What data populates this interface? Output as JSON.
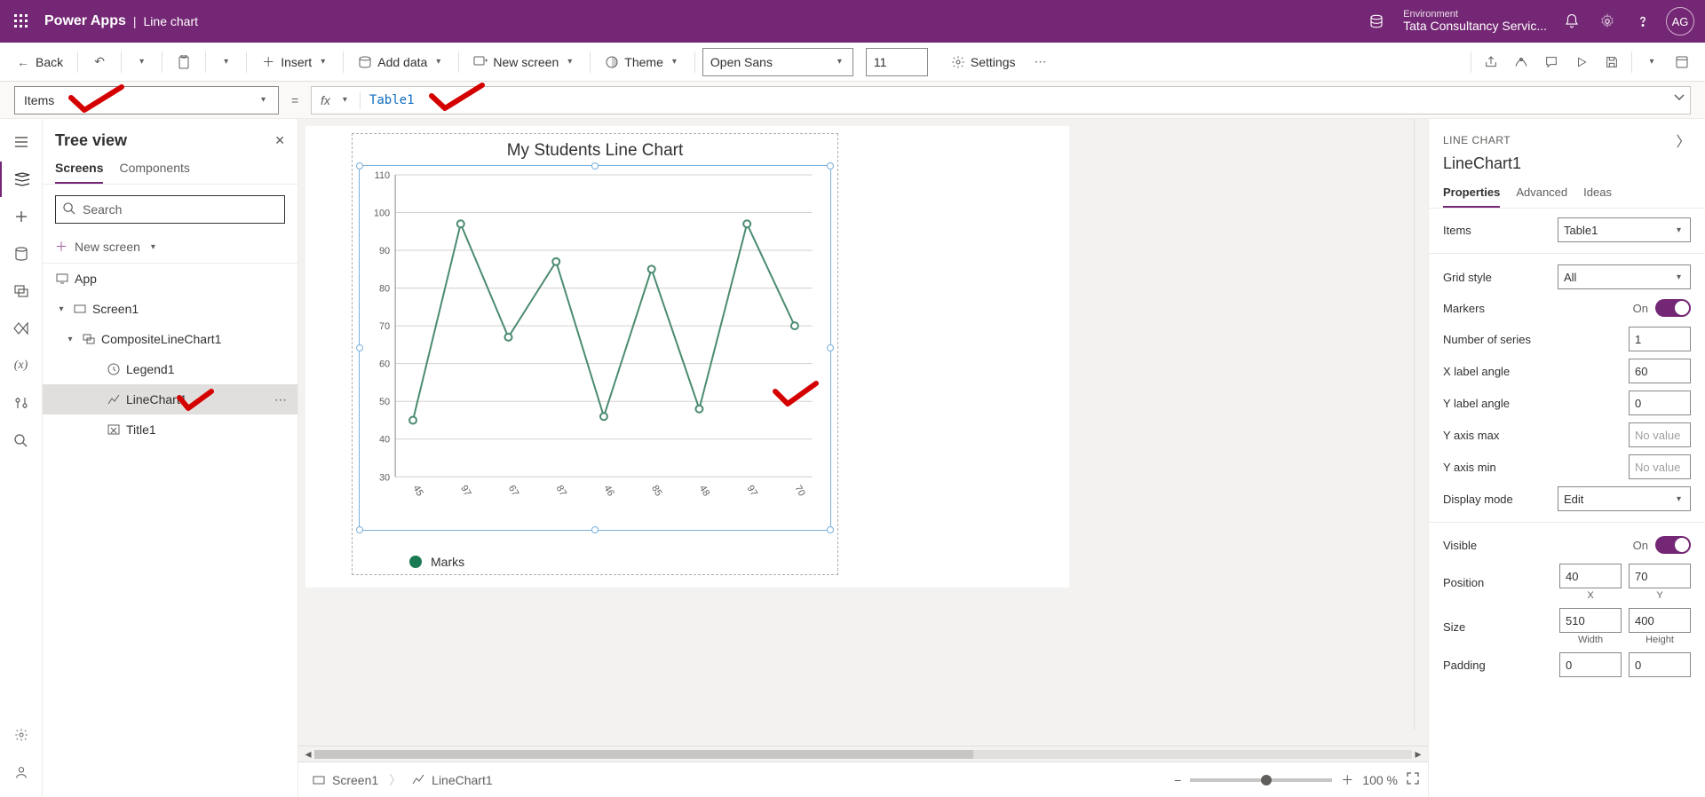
{
  "header": {
    "product": "Power Apps",
    "title": "Line chart",
    "env_label": "Environment",
    "env_name": "Tata Consultancy Servic...",
    "avatar": "AG"
  },
  "cmd": {
    "back": "Back",
    "insert": "Insert",
    "add_data": "Add data",
    "new_screen": "New screen",
    "theme": "Theme",
    "font": "Open Sans",
    "font_size": "11",
    "settings": "Settings"
  },
  "formula": {
    "property": "Items",
    "value": "Table1"
  },
  "tree": {
    "title": "Tree view",
    "tab_screens": "Screens",
    "tab_components": "Components",
    "search_placeholder": "Search",
    "new_screen": "New screen",
    "app": "App",
    "screen1": "Screen1",
    "composite": "CompositeLineChart1",
    "legend": "Legend1",
    "linechart": "LineChart1",
    "title1": "Title1"
  },
  "breadcrumbs": {
    "s1": "Screen1",
    "lc": "LineChart1",
    "zoom": "100 %"
  },
  "chart_data": {
    "type": "line",
    "title": "My Students Line Chart",
    "legend": "Marks",
    "categories": [
      "45",
      "97",
      "67",
      "87",
      "46",
      "85",
      "48",
      "97",
      "70"
    ],
    "values": [
      45,
      97,
      67,
      87,
      46,
      85,
      48,
      97,
      70
    ],
    "y_ticks": [
      30,
      40,
      50,
      60,
      70,
      80,
      90,
      100,
      110
    ],
    "ylim": [
      30,
      110
    ],
    "xlabel": "",
    "ylabel": ""
  },
  "props": {
    "header": "LINE CHART",
    "name": "LineChart1",
    "tab_properties": "Properties",
    "tab_advanced": "Advanced",
    "tab_ideas": "Ideas",
    "items_label": "Items",
    "items_value": "Table1",
    "grid_label": "Grid style",
    "grid_value": "All",
    "markers_label": "Markers",
    "markers_value": "On",
    "num_series_label": "Number of series",
    "num_series_value": "1",
    "xlabel_angle_label": "X label angle",
    "xlabel_angle_value": "60",
    "ylabel_angle_label": "Y label angle",
    "ylabel_angle_value": "0",
    "ymax_label": "Y axis max",
    "ymax_value": "No value",
    "ymin_label": "Y axis min",
    "ymin_value": "No value",
    "display_mode_label": "Display mode",
    "display_mode_value": "Edit",
    "visible_label": "Visible",
    "visible_value": "On",
    "position_label": "Position",
    "pos_x": "40",
    "pos_y": "70",
    "pos_x_sub": "X",
    "pos_y_sub": "Y",
    "size_label": "Size",
    "size_w": "510",
    "size_h": "400",
    "size_w_sub": "Width",
    "size_h_sub": "Height",
    "padding_label": "Padding",
    "pad_a": "0",
    "pad_b": "0"
  }
}
